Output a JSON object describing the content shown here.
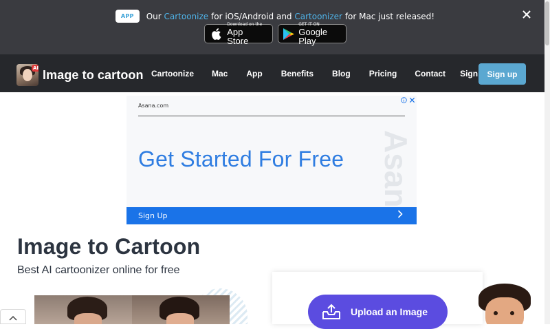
{
  "promo": {
    "badge": "APP",
    "text_prefix": "Our ",
    "link1": "Cartoonize",
    "text_mid": " for iOS/Android and ",
    "link2": "Cartoonizer",
    "text_suffix": " for Mac just released!",
    "close_icon": "close-icon",
    "app_store": {
      "small": "Download on the",
      "big": "App Store"
    },
    "google_play": {
      "small": "GET IT ON",
      "big": "Google Play"
    }
  },
  "nav": {
    "logo_text": "Image to cartoon",
    "logo_badge": "AI",
    "links": [
      "Cartoonize",
      "Mac",
      "App",
      "Benefits",
      "Blog",
      "Pricing",
      "Contact",
      "Sign in"
    ],
    "signup": "Sign up"
  },
  "ad": {
    "domain": "Asana.com",
    "headline": "Get Started For Free",
    "watermark": "Asana.c",
    "cta": "Sign Up",
    "info_icon": "info-icon",
    "close_icon": "close-icon"
  },
  "hero": {
    "title": "Image to Cartoon",
    "subtitle": "Best AI cartoonizer online for free",
    "upload_label": "Upload an Image"
  },
  "colors": {
    "banner_bg": "#3a3b40",
    "nav_bg": "#26282c",
    "accent_link": "#4fb3e8",
    "signup_bg": "#5ba8d1",
    "ad_blue": "#1a73e8",
    "upload_bg": "#5b4ce0"
  }
}
